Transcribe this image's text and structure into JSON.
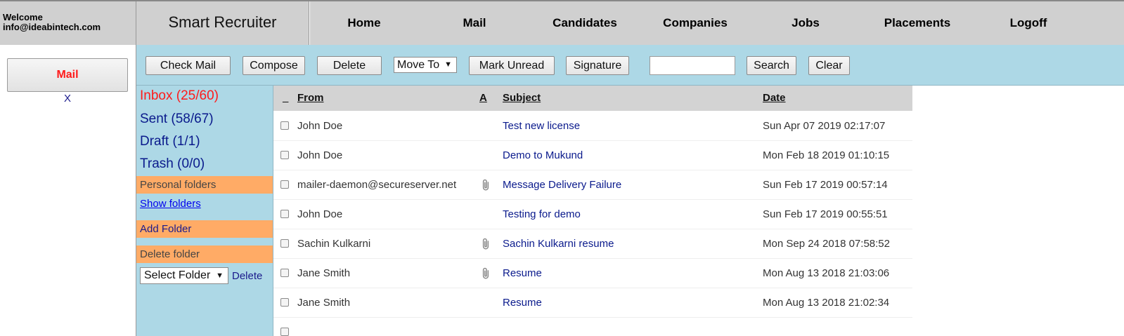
{
  "header": {
    "welcome_label": "Welcome",
    "user_email": "info@ideabintech.com",
    "brand": "Smart Recruiter",
    "nav": [
      "Home",
      "Mail",
      "Candidates",
      "Companies",
      "Jobs",
      "Placements",
      "Logoff"
    ]
  },
  "left_panel": {
    "active_tab": "Mail",
    "close_label": "X"
  },
  "toolbar": {
    "check_mail": "Check Mail",
    "compose": "Compose",
    "delete": "Delete",
    "move_to": "Move To",
    "mark_unread": "Mark Unread",
    "signature": "Signature",
    "search_value": "",
    "search": "Search",
    "clear": "Clear"
  },
  "folders": {
    "inbox": "Inbox (25/60)",
    "sent": "Sent (58/67)",
    "draft": "Draft (1/1)",
    "trash": "Trash (0/0)",
    "personal_folders": "Personal folders",
    "show_folders": "Show folders",
    "add_folder": "Add Folder",
    "delete_folder_header": "Delete folder",
    "select_folder": "Select Folder",
    "delete_link": "Delete"
  },
  "table": {
    "columns": {
      "select": "_",
      "from": "From",
      "attachment": "A",
      "subject": "Subject",
      "date": "Date"
    },
    "rows": [
      {
        "from": "John Doe",
        "attachment": false,
        "subject": "Test new license",
        "date": "Sun Apr 07 2019 02:17:07"
      },
      {
        "from": "John Doe",
        "attachment": false,
        "subject": "Demo to Mukund",
        "date": "Mon Feb 18 2019 01:10:15"
      },
      {
        "from": "mailer-daemon@secureserver.net",
        "attachment": true,
        "subject": "Message Delivery Failure",
        "date": "Sun Feb 17 2019 00:57:14"
      },
      {
        "from": "John Doe",
        "attachment": false,
        "subject": "Testing for demo",
        "date": "Sun Feb 17 2019 00:55:51"
      },
      {
        "from": "Sachin Kulkarni",
        "attachment": true,
        "subject": "Sachin Kulkarni resume",
        "date": "Mon Sep 24 2018 07:58:52"
      },
      {
        "from": "Jane Smith",
        "attachment": true,
        "subject": "Resume",
        "date": "Mon Aug 13 2018 21:03:06"
      },
      {
        "from": "Jane Smith",
        "attachment": false,
        "subject": "Resume",
        "date": "Mon Aug 13 2018 21:02:34"
      },
      {
        "from": "",
        "attachment": false,
        "subject": "",
        "date": ""
      }
    ]
  },
  "colors": {
    "toolbar_bg": "#add8e6",
    "header_bg": "#d0d0d0",
    "folder_header_bg": "#ffab66",
    "active_red": "#ff1a1a",
    "link_navy": "#0a1a8c"
  },
  "icons": {
    "attachment": "paperclip-icon",
    "dropdown": "caret-down-icon"
  }
}
